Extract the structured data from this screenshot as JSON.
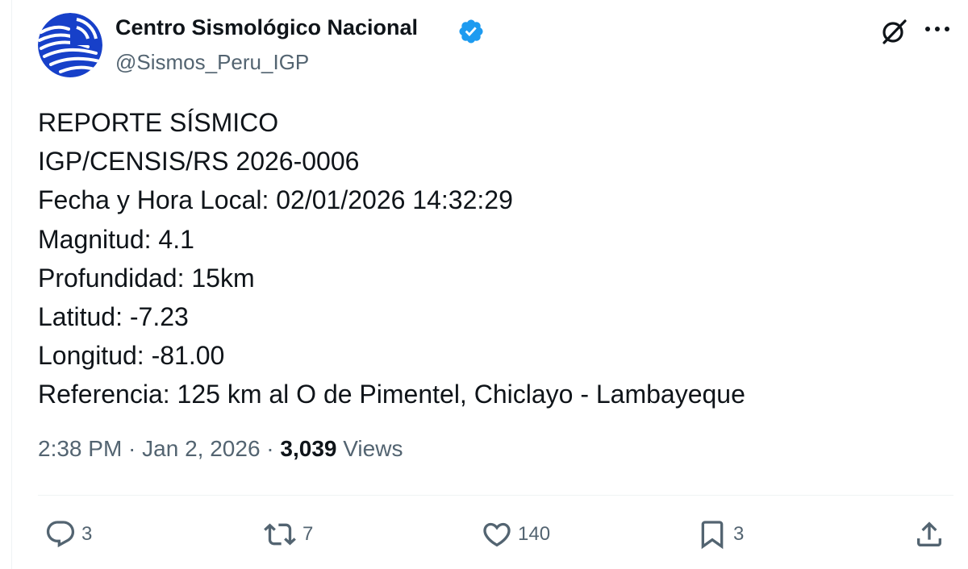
{
  "account": {
    "display_name": "Centro Sismológico Nacional",
    "handle": "@Sismos_Peru_IGP",
    "verified": true,
    "avatar_icon": "igp-logo-icon"
  },
  "tweet": {
    "lines": [
      "REPORTE SÍSMICO",
      "IGP/CENSIS/RS 2026-0006",
      "Fecha y Hora Local: 02/01/2026 14:32:29",
      "Magnitud: 4.1",
      "Profundidad: 15km",
      "Latitud: -7.23",
      "Longitud: -81.00",
      "Referencia: 125 km al O de Pimentel, Chiclayo - Lambayeque"
    ]
  },
  "meta": {
    "time": "2:38 PM",
    "separator": " · ",
    "date": "Jan 2, 2026",
    "views_count": "3,039",
    "views_label": "Views"
  },
  "actions": {
    "reply": {
      "icon": "reply-icon",
      "count": "3"
    },
    "retweet": {
      "icon": "retweet-icon",
      "count": "7"
    },
    "like": {
      "icon": "heart-icon",
      "count": "140"
    },
    "bookmark": {
      "icon": "bookmark-icon",
      "count": "3"
    },
    "share": {
      "icon": "share-icon"
    }
  },
  "colors": {
    "text": "#0f1419",
    "muted": "#536471",
    "verified_blue": "#1d9bf0",
    "avatar_blue": "#1740c9"
  }
}
